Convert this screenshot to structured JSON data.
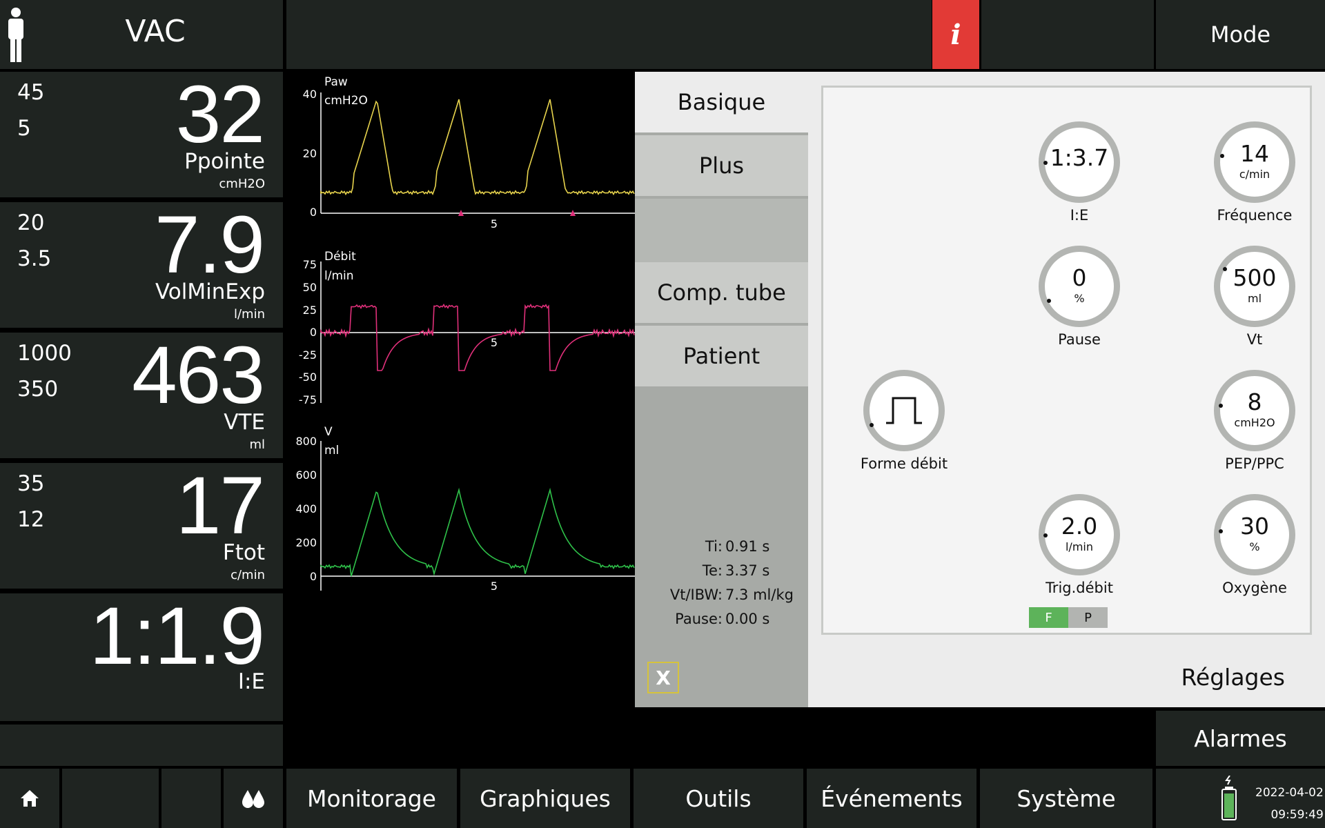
{
  "header": {
    "mode_name": "VAC",
    "info_label": "i",
    "mode_button": "Mode"
  },
  "parameters": [
    {
      "upper_limit": "45",
      "lower_limit": "5",
      "value": "32",
      "name": "Ppointe",
      "unit": "cmH2O"
    },
    {
      "upper_limit": "20",
      "lower_limit": "3.5",
      "value": "7.9",
      "name": "VolMinExp",
      "unit": "l/min"
    },
    {
      "upper_limit": "1000",
      "lower_limit": "350",
      "value": "463",
      "name": "VTE",
      "unit": "ml"
    },
    {
      "upper_limit": "35",
      "lower_limit": "12",
      "value": "17",
      "name": "Ftot",
      "unit": "c/min"
    },
    {
      "upper_limit": "",
      "lower_limit": "",
      "value": "1:1.9",
      "name": "I:E",
      "unit": ""
    }
  ],
  "graphs": {
    "pressure": {
      "name": "Paw",
      "unit": "cmH2O",
      "ticks": [
        "40",
        "20",
        "0"
      ],
      "x_tick": "5",
      "color": "#e8d44d"
    },
    "flow": {
      "name": "Débit",
      "unit": "l/min",
      "ticks": [
        "75",
        "50",
        "25",
        "0",
        "-25",
        "-50",
        "-75"
      ],
      "x_tick": "5",
      "color": "#e0307a"
    },
    "volume": {
      "name": "V",
      "unit": "ml",
      "ticks": [
        "800",
        "600",
        "400",
        "200",
        "0"
      ],
      "x_tick": "5",
      "color": "#2fc24a"
    }
  },
  "panel": {
    "tabs": [
      {
        "label": "Basique"
      },
      {
        "label": "Plus"
      },
      {
        "label": ""
      },
      {
        "label": "Comp. tube"
      },
      {
        "label": "Patient"
      }
    ],
    "info": [
      {
        "key": "Ti:",
        "value": "0.91 s"
      },
      {
        "key": "Te:",
        "value": "3.37 s"
      },
      {
        "key": "Vt/IBW:",
        "value": "7.3 ml/kg"
      },
      {
        "key": "Pause:",
        "value": "0.00 s"
      }
    ],
    "close_label": "X",
    "knobs": {
      "ie": {
        "value": "1:3.7",
        "unit": "",
        "label": "I:E"
      },
      "frequence": {
        "value": "14",
        "unit": "c/min",
        "label": "Fréquence"
      },
      "pause": {
        "value": "0",
        "unit": "%",
        "label": "Pause"
      },
      "vt": {
        "value": "500",
        "unit": "ml",
        "label": "Vt"
      },
      "forme": {
        "value": "",
        "unit": "",
        "label": "Forme débit"
      },
      "pep": {
        "value": "8",
        "unit": "cmH2O",
        "label": "PEP/PPC"
      },
      "trig": {
        "value": "2.0",
        "unit": "l/min",
        "label": "Trig.débit"
      },
      "oxygene": {
        "value": "30",
        "unit": "%",
        "label": "Oxygène"
      }
    },
    "trigger_toggle": {
      "f": "F",
      "p": "P"
    },
    "footer_label": "Réglages"
  },
  "alarmes_button": "Alarmes",
  "nav": {
    "items": [
      "Monitorage",
      "Graphiques",
      "Outils",
      "Événements",
      "Système"
    ]
  },
  "status": {
    "date": "2022-04-02",
    "time": "09:59:49",
    "battery_color": "#5db35a"
  },
  "colors": {
    "panel_dark": "#1f2421",
    "alert_red": "#e23a36",
    "active_green": "#5db35a"
  }
}
